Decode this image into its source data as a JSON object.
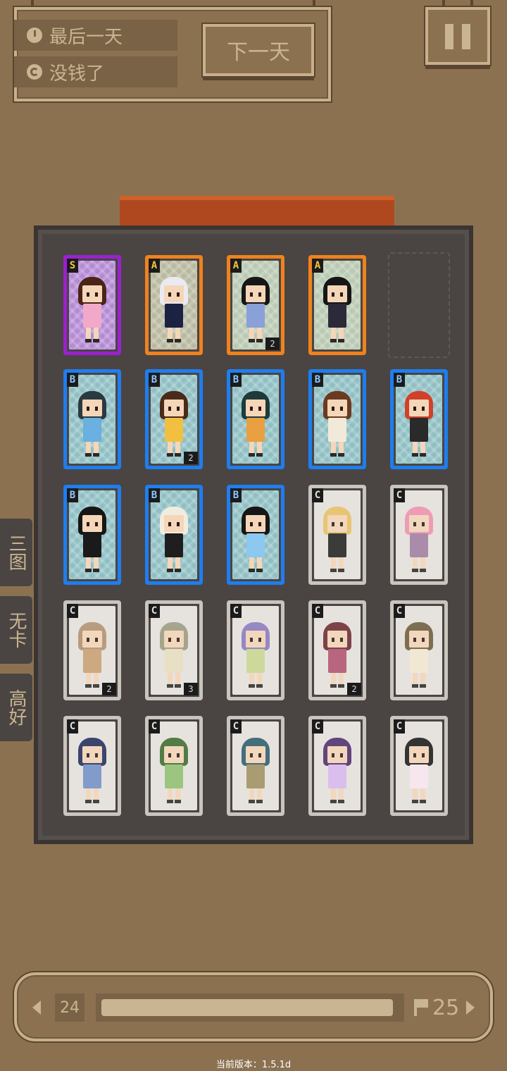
{
  "status": {
    "day_text": "最后一天",
    "money_text": "没钱了",
    "next_day_label": "下一天"
  },
  "side_tabs": [
    "三图",
    "无卡",
    "高好"
  ],
  "colors": {
    "S": "#9b21d0",
    "A": "#f0821e",
    "B": "#1e7ef0",
    "C": "#c9c4bd"
  },
  "cards": [
    {
      "rank": "S",
      "count": "",
      "hair": "#4a2418",
      "outfit": "#f2a8c8",
      "inner": "#b48ad4"
    },
    {
      "rank": "A",
      "count": "",
      "hair": "#eaeaf2",
      "outfit": "#1c2242",
      "inner": "#b9b9a0"
    },
    {
      "rank": "A",
      "count": "2",
      "hair": "#161616",
      "outfit": "#8aa0d8",
      "inner": "#b9c9b2"
    },
    {
      "rank": "A",
      "count": "",
      "hair": "#161616",
      "outfit": "#2a2a3a",
      "inner": "#b9c9b2"
    },
    {
      "rank": "B",
      "count": "",
      "hair": "#2a3a42",
      "outfit": "#6ab0e0",
      "inner": "#8fbfc3"
    },
    {
      "rank": "B",
      "count": "2",
      "hair": "#4a2a18",
      "outfit": "#f2c040",
      "inner": "#8fbfc3"
    },
    {
      "rank": "B",
      "count": "",
      "hair": "#1f3a3a",
      "outfit": "#e8a040",
      "inner": "#8fbfc3"
    },
    {
      "rank": "B",
      "count": "",
      "hair": "#6a3a22",
      "outfit": "#f2ead8",
      "inner": "#8fbfc3"
    },
    {
      "rank": "B",
      "count": "",
      "hair": "#d0402a",
      "outfit": "#2a2a2a",
      "inner": "#8fbfc3"
    },
    {
      "rank": "B",
      "count": "",
      "hair": "#161616",
      "outfit": "#1a1a1a",
      "inner": "#8fbfc3"
    },
    {
      "rank": "B",
      "count": "",
      "hair": "#f0ece0",
      "outfit": "#1e1e1e",
      "inner": "#8fbfc3"
    },
    {
      "rank": "B",
      "count": "",
      "hair": "#161616",
      "outfit": "#8cc8f0",
      "inner": "#8fbfc3"
    },
    {
      "rank": "C",
      "count": "",
      "hair": "#e8c060",
      "outfit": "#1e1e1e",
      "inner": "#e6e3de"
    },
    {
      "rank": "C",
      "count": "",
      "hair": "#f090b0",
      "outfit": "#a07ca0",
      "inner": "#e6e3de"
    },
    {
      "rank": "C",
      "count": "2",
      "hair": "#b09070",
      "outfit": "#c8a070",
      "inner": "#e6e3de"
    },
    {
      "rank": "C",
      "count": "3",
      "hair": "#9a9a80",
      "outfit": "#e8e0c0",
      "inner": "#e6e3de"
    },
    {
      "rank": "C",
      "count": "",
      "hair": "#8a78c0",
      "outfit": "#c8d890",
      "inner": "#e6e3de"
    },
    {
      "rank": "C",
      "count": "2",
      "hair": "#6a2830",
      "outfit": "#b05070",
      "inner": "#e6e3de"
    },
    {
      "rank": "C",
      "count": "",
      "hair": "#6a5a38",
      "outfit": "#f2ead0",
      "inner": "#e6e3de"
    },
    {
      "rank": "C",
      "count": "",
      "hair": "#1e2a5a",
      "outfit": "#7090c8",
      "inner": "#e6e3de"
    },
    {
      "rank": "C",
      "count": "",
      "hair": "#3a6a2a",
      "outfit": "#90c070",
      "inner": "#e6e3de"
    },
    {
      "rank": "C",
      "count": "",
      "hair": "#2a5a6a",
      "outfit": "#a09060",
      "inner": "#e6e3de"
    },
    {
      "rank": "C",
      "count": "",
      "hair": "#4a2a6a",
      "outfit": "#d8b8f0",
      "inner": "#e6e3de"
    },
    {
      "rank": "C",
      "count": "",
      "hair": "#161616",
      "outfit": "#f8e8f0",
      "inner": "#e6e3de"
    }
  ],
  "progress": {
    "current_day": "24",
    "goal_day": "25",
    "fill_fraction": 0.98
  },
  "version_text": "当前版本：1.5.1d"
}
